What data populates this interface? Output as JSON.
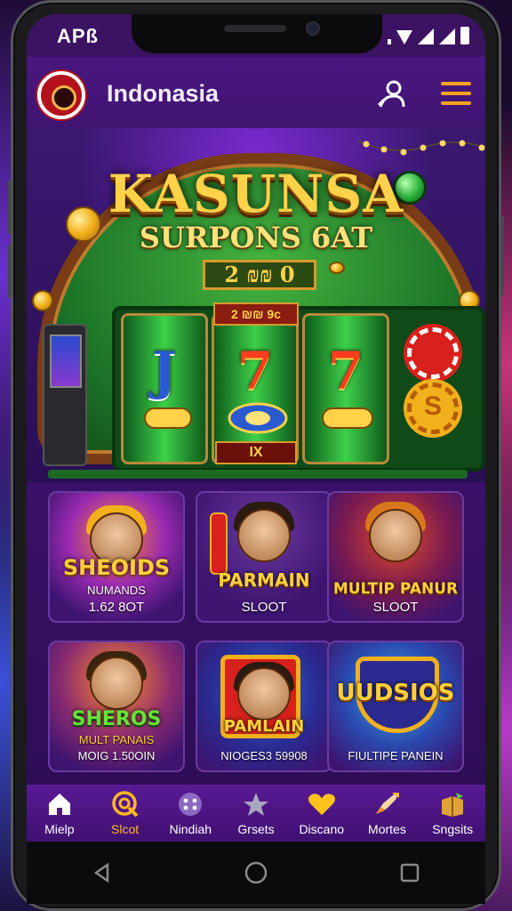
{
  "status_bar": {
    "carrier": "APß"
  },
  "header": {
    "brand": "Indonasia",
    "logo_icon": "roulette-logo-icon",
    "user_icon": "user-icon",
    "menu_icon": "hamburger-menu-icon"
  },
  "hero": {
    "title": "KASUNSA",
    "subtitle": "SURPONS 6AT",
    "plaque": "2 ₪₪ 0",
    "reel_top_label": "2 ₪₪ 9c",
    "reel_bottom_label": "IX",
    "reel_symbols": [
      "J",
      "7",
      "7"
    ],
    "chip_symbol": "S"
  },
  "games": [
    {
      "title": "SHEOIDS",
      "line1": "NUMANDS",
      "line2": "1.62 8OT"
    },
    {
      "title": "PARMAIN",
      "line1": "SLOOT",
      "line2": ""
    },
    {
      "title": "MULTIP PANUR",
      "line1": "SLOOT",
      "line2": ""
    },
    {
      "title": "SHEROS",
      "line1": "MULT PANAIS",
      "line2": "MOIG 1.50OIN"
    },
    {
      "title": "PAMLAIN",
      "line1": "NIOGES3 59908",
      "line2": ""
    },
    {
      "title": "UUDSIOS",
      "line1": "FIULTIPE PANEIN",
      "line2": ""
    }
  ],
  "nav": [
    {
      "label": "Mielp",
      "icon": "home-icon",
      "active": false
    },
    {
      "label": "Slcot",
      "icon": "slot-icon",
      "active": true
    },
    {
      "label": "Nindiah",
      "icon": "dice-icon",
      "active": false
    },
    {
      "label": "Grsets",
      "icon": "star-icon",
      "active": false
    },
    {
      "label": "Discano",
      "icon": "heart-icon",
      "active": false
    },
    {
      "label": "Mortes",
      "icon": "rocket-icon",
      "active": false
    },
    {
      "label": "Sngsits",
      "icon": "gift-box-icon",
      "active": false
    }
  ],
  "colors": {
    "accent": "#ffb826",
    "header_bg": "#4a1780",
    "nav_bg": "#5a1a96",
    "gold": "#ffd24a"
  }
}
